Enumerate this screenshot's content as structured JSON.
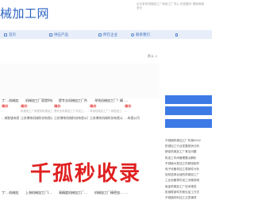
{
  "header": {
    "title": "械加工网",
    "notes": [
      "企业发布机械加工厂商品工厂中心 在线展示·搜索商城",
      "多元"
    ]
  },
  "nav": {
    "items": [
      {
        "label": "首页",
        "icon": "home-icon"
      },
      {
        "label": "供应产品",
        "icon": "grid-icon"
      },
      {
        "label": "所在企业",
        "icon": "building-icon"
      },
      {
        "label": "联系我们",
        "icon": "info-icon"
      },
      {
        "label": "",
        "icon": "phone-icon"
      }
    ]
  },
  "sort": {
    "label": "默认 ∨"
  },
  "products": [
    {
      "name": "丁'…机械加工厂家…",
      "badge": "询价",
      "desc": "…",
      "company": "…械制造有限公司"
    },
    {
      "name": "机械加工厂家提供机…",
      "badge": "询价",
      "desc": "机械加工厂家提供机械加工…",
      "company": "江苏博伟机械科技有限公司"
    },
    {
      "name": "提专业机械加工厂件…",
      "badge": "询价",
      "desc": "提专业机械加工厂件加工…",
      "company": "江苏博伟机械科技有限公司"
    },
    {
      "name": "寻找机械加工厂？精…",
      "badge": "询价",
      "desc": "寻找机械加工厂？精密加工…",
      "company": "江苏博伟机械科技有限公司"
    },
    {
      "name": "…",
      "badge": "询价",
      "desc": "…",
      "company": "…有限公司"
    },
    {
      "name": "丁'…机械加工厂…"
    },
    {
      "name": "上海机械加工厂I…"
    },
    {
      "name": "高精度机械加工厂…"
    },
    {
      "name": "机械加工厂精密加…"
    },
    {
      "name": "…"
    }
  ],
  "sidebar": {
    "buttons": [
      "",
      "",
      ""
    ],
    "news": [
      "不锈钢机械加工厂年报0042",
      "机械加工行业发展现状分析",
      "精密机械加工厂常见问题",
      "机加工车间管理要点解析",
      "不锈钢大型加工件精密制作",
      "电子设备机加工零部件分析",
      "如何选择合适的机械加工厂",
      "工业设备零件加工流程说明",
      "钣金机械加工厂技术规范",
      "机械零部件的常见加工方式",
      "不锈钢材料加工注意事项"
    ]
  },
  "watermark": {
    "text": "千孤秒收录"
  }
}
